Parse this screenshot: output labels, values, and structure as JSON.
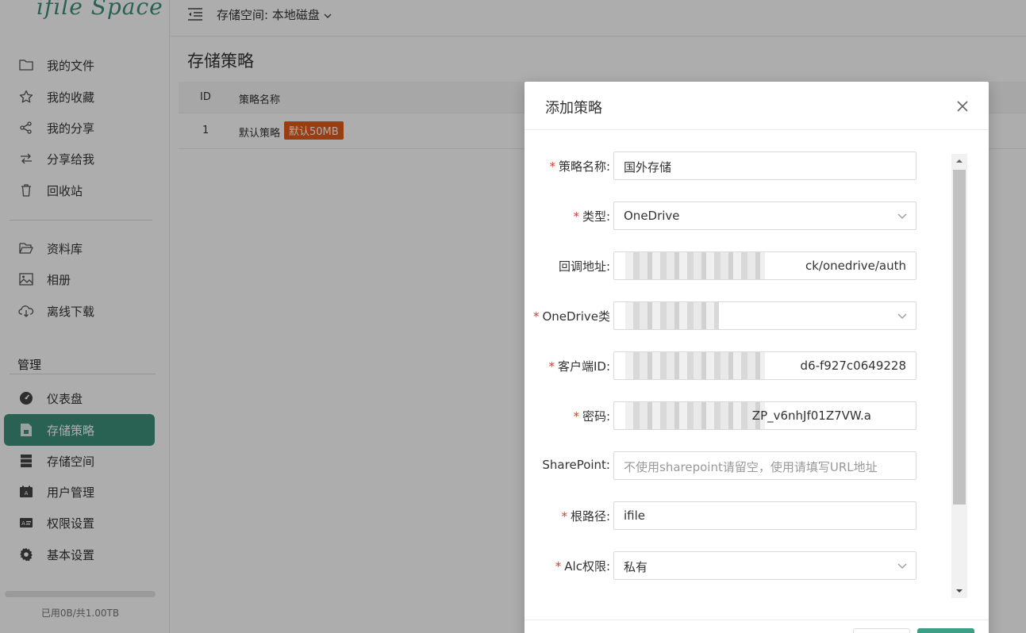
{
  "app": {
    "logo_text": "ifile Space"
  },
  "topbar": {
    "space_label": "存储空间: 本地磁盘"
  },
  "sidebar": {
    "items": [
      {
        "label": "我的文件",
        "icon": "folder-icon"
      },
      {
        "label": "我的收藏",
        "icon": "star-icon"
      },
      {
        "label": "我的分享",
        "icon": "share-icon"
      },
      {
        "label": "分享给我",
        "icon": "share-in-icon"
      },
      {
        "label": "回收站",
        "icon": "trash-icon"
      },
      {
        "label": "资料库",
        "icon": "folder-open-icon"
      },
      {
        "label": "相册",
        "icon": "image-icon"
      },
      {
        "label": "离线下载",
        "icon": "cloud-download-icon"
      }
    ],
    "section_title": "管理",
    "admin_items": [
      {
        "label": "仪表盘",
        "icon": "dashboard-icon"
      },
      {
        "label": "存储策略",
        "icon": "storage-policy-icon",
        "active": true
      },
      {
        "label": "存储空间",
        "icon": "server-icon"
      },
      {
        "label": "用户管理",
        "icon": "user-card-icon"
      },
      {
        "label": "权限设置",
        "icon": "id-card-icon"
      },
      {
        "label": "基本设置",
        "icon": "settings-icon"
      }
    ],
    "usage_text": "已用0B/共1.00TB",
    "usage_fraction": 0
  },
  "main": {
    "title": "存储策略",
    "table": {
      "headers": [
        "ID",
        "策略名称"
      ],
      "rows": [
        {
          "id": "1",
          "name": "默认策略",
          "badge": "默认50MB"
        }
      ]
    }
  },
  "dialog": {
    "title": "添加策略",
    "fields": [
      {
        "label": "策略名称:",
        "required": true,
        "value": "国外存储"
      },
      {
        "label": "类型:",
        "required": true,
        "value": "OneDrive",
        "select": true
      },
      {
        "label": "回调地址:",
        "required": false,
        "value": "ck/onedrive/auth",
        "redacted": true
      },
      {
        "label": "OneDrive类",
        "required": true,
        "value": "",
        "select": true,
        "redacted": true
      },
      {
        "label": "客户端ID:",
        "required": true,
        "value": "d6-f927c0649228",
        "redacted": true
      },
      {
        "label": "密码:",
        "required": true,
        "value": "ZP_v6nhJf01Z7VW.a",
        "redacted": true
      },
      {
        "label": "SharePoint:",
        "required": false,
        "value": "",
        "placeholder": "不使用sharepoint请留空，使用请填写URL地址"
      },
      {
        "label": "根路径:",
        "required": true,
        "value": "ifile"
      },
      {
        "label": "Alc权限:",
        "required": true,
        "value": "私有",
        "select": true
      }
    ]
  },
  "colors": {
    "accent": "#3d8f7b",
    "badge": "#e25b1b",
    "required": "#e0392b"
  }
}
